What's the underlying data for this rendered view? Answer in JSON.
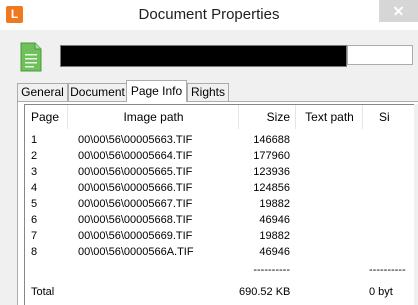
{
  "window": {
    "title": "Document Properties",
    "app_icon_letter": "L",
    "accent_color": "#f0781e"
  },
  "header": {
    "document_icon": "document-icon",
    "filename_redacted": true
  },
  "tabs": [
    {
      "label": "General",
      "active": false
    },
    {
      "label": "Document",
      "active": false
    },
    {
      "label": "Page Info",
      "active": true
    },
    {
      "label": "Rights",
      "active": false
    }
  ],
  "table": {
    "columns": {
      "page": "Page",
      "image_path": "Image path",
      "size": "Size",
      "text_path": "Text path",
      "text_size": "Si"
    },
    "rows": [
      {
        "page": "1",
        "image_path": "00\\00\\56\\00005663.TIF",
        "size": "146688",
        "text_path": "",
        "text_size": ""
      },
      {
        "page": "2",
        "image_path": "00\\00\\56\\00005664.TIF",
        "size": "177960",
        "text_path": "",
        "text_size": ""
      },
      {
        "page": "3",
        "image_path": "00\\00\\56\\00005665.TIF",
        "size": "123936",
        "text_path": "",
        "text_size": ""
      },
      {
        "page": "4",
        "image_path": "00\\00\\56\\00005666.TIF",
        "size": "124856",
        "text_path": "",
        "text_size": ""
      },
      {
        "page": "5",
        "image_path": "00\\00\\56\\00005667.TIF",
        "size": "19882",
        "text_path": "",
        "text_size": ""
      },
      {
        "page": "6",
        "image_path": "00\\00\\56\\00005668.TIF",
        "size": "46946",
        "text_path": "",
        "text_size": ""
      },
      {
        "page": "7",
        "image_path": "00\\00\\56\\00005669.TIF",
        "size": "19882",
        "text_path": "",
        "text_size": ""
      },
      {
        "page": "8",
        "image_path": "00\\00\\56\\0000566A.TIF",
        "size": "46946",
        "text_path": "",
        "text_size": ""
      }
    ],
    "separator_row": {
      "page": "",
      "image_path": "",
      "size": "----------",
      "text_path": "",
      "text_size": "----------"
    },
    "total_row": {
      "page": "Total",
      "image_path": "",
      "size": "690.52 KB",
      "text_path": "",
      "text_size": "0 byt"
    }
  }
}
